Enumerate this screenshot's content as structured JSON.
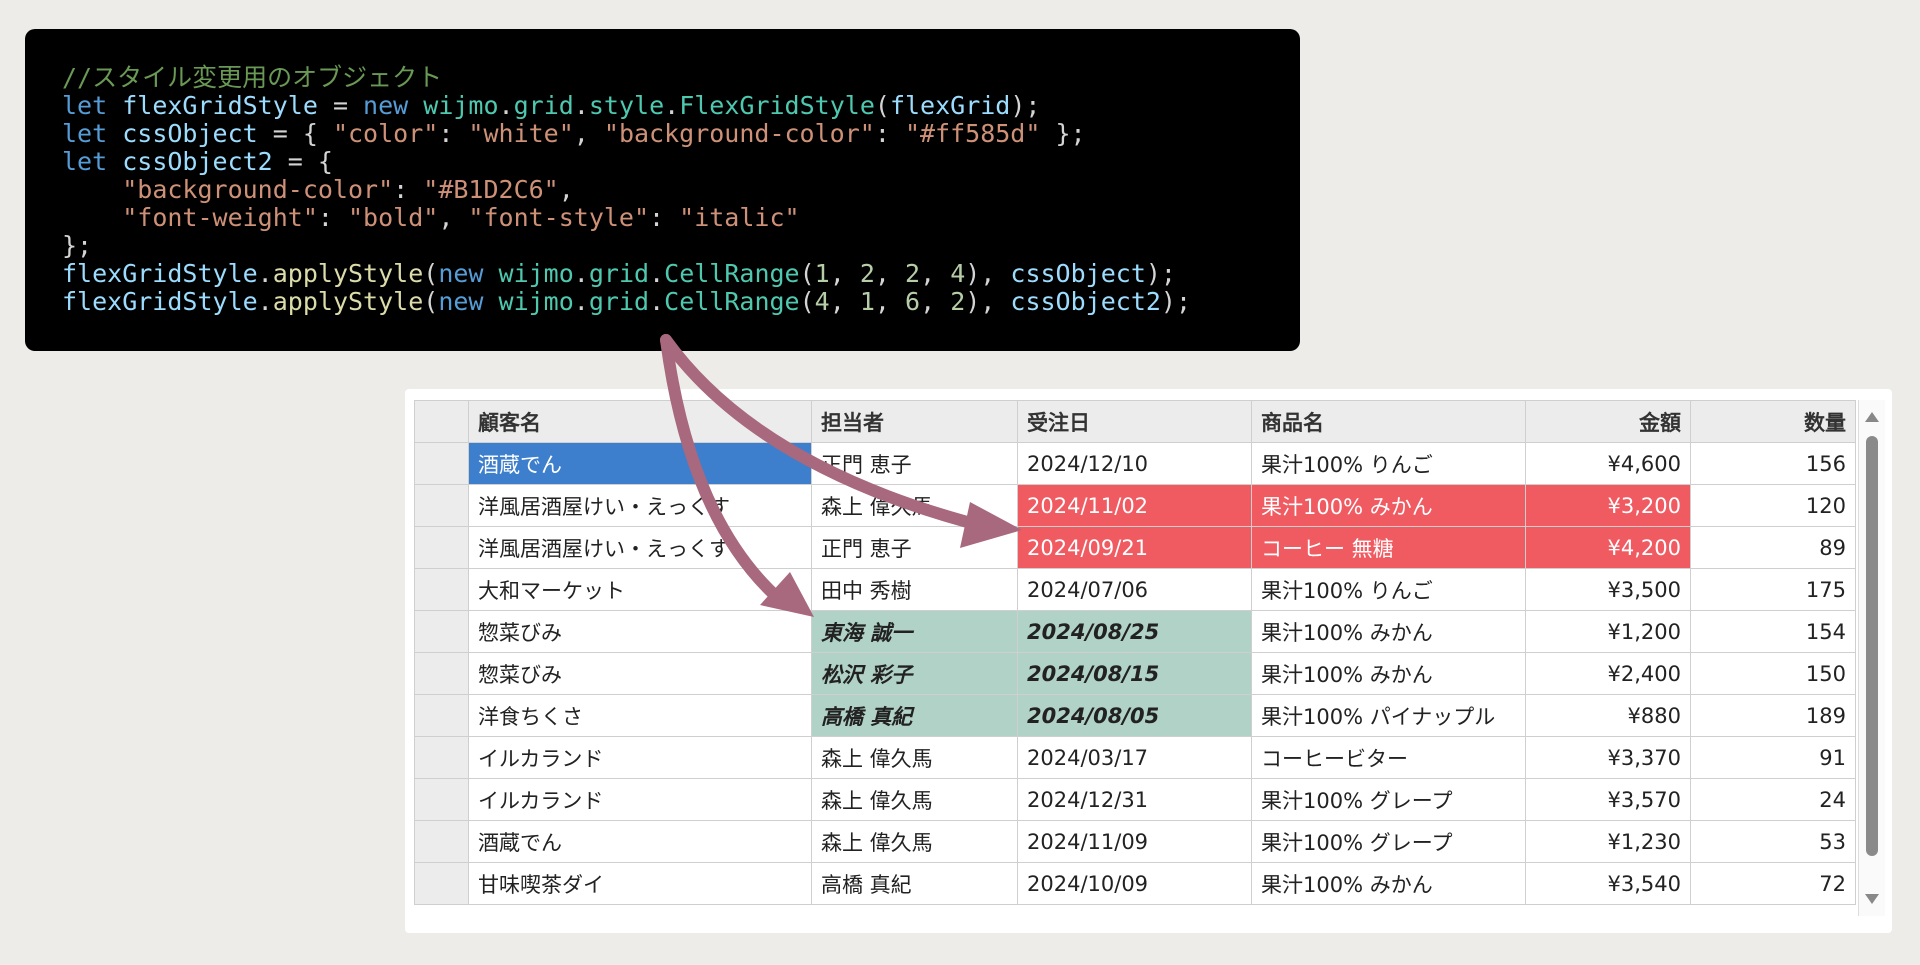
{
  "code": {
    "lines": [
      [
        [
          "c",
          "//スタイル変更用のオブジェクト"
        ]
      ],
      [
        [
          "k",
          "let"
        ],
        [
          "p",
          " "
        ],
        [
          "i",
          "flexGridStyle"
        ],
        [
          "p",
          " = "
        ],
        [
          "k",
          "new"
        ],
        [
          "p",
          " "
        ],
        [
          "n",
          "wijmo"
        ],
        [
          "p",
          "."
        ],
        [
          "n",
          "grid"
        ],
        [
          "p",
          "."
        ],
        [
          "n",
          "style"
        ],
        [
          "p",
          "."
        ],
        [
          "n",
          "FlexGridStyle"
        ],
        [
          "p",
          "("
        ],
        [
          "i",
          "flexGrid"
        ],
        [
          "p",
          ");"
        ]
      ],
      [
        [
          "k",
          "let"
        ],
        [
          "p",
          " "
        ],
        [
          "i",
          "cssObject"
        ],
        [
          "p",
          " = { "
        ],
        [
          "s",
          "\"color\""
        ],
        [
          "p",
          ": "
        ],
        [
          "s",
          "\"white\""
        ],
        [
          "p",
          ", "
        ],
        [
          "s",
          "\"background-color\""
        ],
        [
          "p",
          ": "
        ],
        [
          "s",
          "\"#ff585d\""
        ],
        [
          "p",
          " };"
        ]
      ],
      [
        [
          "k",
          "let"
        ],
        [
          "p",
          " "
        ],
        [
          "i",
          "cssObject2"
        ],
        [
          "p",
          " = {"
        ]
      ],
      [
        [
          "p",
          "    "
        ],
        [
          "s",
          "\"background-color\""
        ],
        [
          "p",
          ": "
        ],
        [
          "s",
          "\"#B1D2C6\""
        ],
        [
          "p",
          ","
        ]
      ],
      [
        [
          "p",
          "    "
        ],
        [
          "s",
          "\"font-weight\""
        ],
        [
          "p",
          ": "
        ],
        [
          "s",
          "\"bold\""
        ],
        [
          "p",
          ", "
        ],
        [
          "s",
          "\"font-style\""
        ],
        [
          "p",
          ": "
        ],
        [
          "s",
          "\"italic\""
        ]
      ],
      [
        [
          "p",
          "};"
        ]
      ],
      [
        [
          "i",
          "flexGridStyle"
        ],
        [
          "p",
          "."
        ],
        [
          "f",
          "applyStyle"
        ],
        [
          "p",
          "("
        ],
        [
          "k",
          "new"
        ],
        [
          "p",
          " "
        ],
        [
          "n",
          "wijmo"
        ],
        [
          "p",
          "."
        ],
        [
          "n",
          "grid"
        ],
        [
          "p",
          "."
        ],
        [
          "n",
          "CellRange"
        ],
        [
          "p",
          "("
        ],
        [
          "m",
          "1"
        ],
        [
          "p",
          ", "
        ],
        [
          "m",
          "2"
        ],
        [
          "p",
          ", "
        ],
        [
          "m",
          "2"
        ],
        [
          "p",
          ", "
        ],
        [
          "m",
          "4"
        ],
        [
          "p",
          "), "
        ],
        [
          "i",
          "cssObject"
        ],
        [
          "p",
          ");"
        ]
      ],
      [
        [
          "i",
          "flexGridStyle"
        ],
        [
          "p",
          "."
        ],
        [
          "f",
          "applyStyle"
        ],
        [
          "p",
          "("
        ],
        [
          "k",
          "new"
        ],
        [
          "p",
          " "
        ],
        [
          "n",
          "wijmo"
        ],
        [
          "p",
          "."
        ],
        [
          "n",
          "grid"
        ],
        [
          "p",
          "."
        ],
        [
          "n",
          "CellRange"
        ],
        [
          "p",
          "("
        ],
        [
          "m",
          "4"
        ],
        [
          "p",
          ", "
        ],
        [
          "m",
          "1"
        ],
        [
          "p",
          ", "
        ],
        [
          "m",
          "6"
        ],
        [
          "p",
          ", "
        ],
        [
          "m",
          "2"
        ],
        [
          "p",
          "), "
        ],
        [
          "i",
          "cssObject2"
        ],
        [
          "p",
          ");"
        ]
      ]
    ]
  },
  "grid": {
    "columns": [
      {
        "label": "顧客名",
        "align": "left"
      },
      {
        "label": "担当者",
        "align": "left"
      },
      {
        "label": "受注日",
        "align": "left"
      },
      {
        "label": "商品名",
        "align": "left"
      },
      {
        "label": "金額",
        "align": "right"
      },
      {
        "label": "数量",
        "align": "right"
      }
    ],
    "rows": [
      {
        "cells": [
          "酒蔵でん",
          "正門 恵子",
          "2024/12/10",
          "果汁100% りんご",
          "¥4,600",
          "156"
        ],
        "styles": [
          "selected",
          "",
          "",
          "",
          "",
          ""
        ]
      },
      {
        "cells": [
          "洋風居酒屋けい・えっくす",
          "森上 偉久馬",
          "2024/11/02",
          "果汁100% みかん",
          "¥3,200",
          "120"
        ],
        "styles": [
          "",
          "",
          "red",
          "red",
          "red",
          ""
        ]
      },
      {
        "cells": [
          "洋風居酒屋けい・えっくす",
          "正門 恵子",
          "2024/09/21",
          "コーヒー 無糖",
          "¥4,200",
          "89"
        ],
        "styles": [
          "",
          "",
          "red",
          "red",
          "red",
          ""
        ]
      },
      {
        "cells": [
          "大和マーケット",
          "田中 秀樹",
          "2024/07/06",
          "果汁100% りんご",
          "¥3,500",
          "175"
        ],
        "styles": [
          "",
          "",
          "",
          "",
          "",
          ""
        ]
      },
      {
        "cells": [
          "惣菜びみ",
          "東海 誠一",
          "2024/08/25",
          "果汁100% みかん",
          "¥1,200",
          "154"
        ],
        "styles": [
          "",
          "green",
          "green",
          "",
          "",
          ""
        ]
      },
      {
        "cells": [
          "惣菜びみ",
          "松沢 彩子",
          "2024/08/15",
          "果汁100% みかん",
          "¥2,400",
          "150"
        ],
        "styles": [
          "",
          "green",
          "green",
          "",
          "",
          ""
        ]
      },
      {
        "cells": [
          "洋食ちくさ",
          "高橋 真紀",
          "2024/08/05",
          "果汁100% パイナップル",
          "¥880",
          "189"
        ],
        "styles": [
          "",
          "green",
          "green",
          "",
          "",
          ""
        ]
      },
      {
        "cells": [
          "イルカランド",
          "森上 偉久馬",
          "2024/03/17",
          "コーヒービター",
          "¥3,370",
          "91"
        ],
        "styles": [
          "",
          "",
          "",
          "",
          "",
          ""
        ]
      },
      {
        "cells": [
          "イルカランド",
          "森上 偉久馬",
          "2024/12/31",
          "果汁100% グレープ",
          "¥3,570",
          "24"
        ],
        "styles": [
          "",
          "",
          "",
          "",
          "",
          ""
        ]
      },
      {
        "cells": [
          "酒蔵でん",
          "森上 偉久馬",
          "2024/11/09",
          "果汁100% グレープ",
          "¥1,230",
          "53"
        ],
        "styles": [
          "",
          "",
          "",
          "",
          "",
          ""
        ]
      },
      {
        "cells": [
          "甘味喫茶ダイ",
          "高橋 真紀",
          "2024/10/09",
          "果汁100% みかん",
          "¥3,540",
          "72"
        ],
        "styles": [
          "",
          "",
          "",
          "",
          "",
          ""
        ]
      }
    ]
  },
  "colors": {
    "code_background": "#000000",
    "page_background": "#eeece8",
    "selection": "#3d7fcc",
    "red_style": "#f05b62",
    "green_style": "#b1d2c6",
    "arrow": "#a8687e"
  },
  "icons": {
    "scroll_up": "triangle-up-icon",
    "scroll_down": "triangle-down-icon"
  }
}
